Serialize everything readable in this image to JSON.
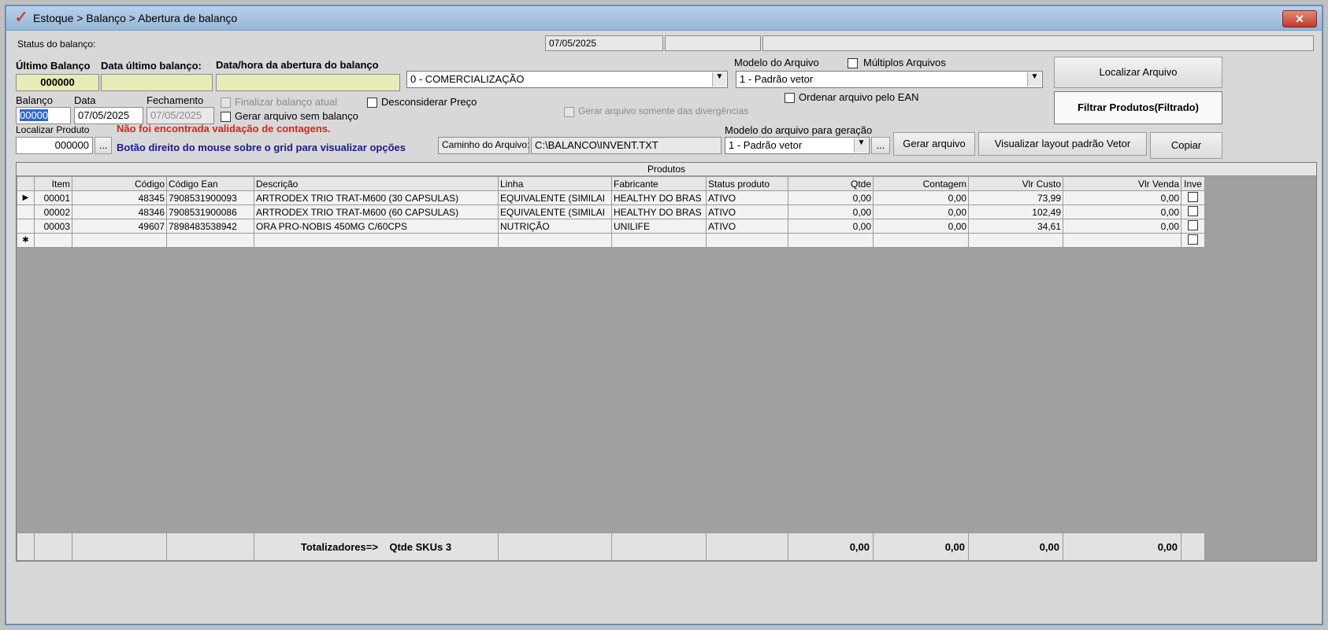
{
  "window": {
    "title": "Estoque > Balanço > Abertura de balanço",
    "close": "✕"
  },
  "status": {
    "label": "Status do balanço:",
    "date": "07/05/2025"
  },
  "header": {
    "ultimo_balanco_label": "Último Balanço",
    "ultimo_balanco_value": "000000",
    "data_ultimo_label": "Data último balanço:",
    "data_abertura_label": "Data/hora da abertura do balanço",
    "tipo_select": "0 - COMERCIALIZAÇÃO",
    "modelo_arquivo_label": "Modelo do Arquivo",
    "modelo_arquivo_select": "1 - Padrão vetor",
    "multiplos_label": "Múltiplos Arquivos",
    "localizar_arquivo_btn": "Localizar Arquivo",
    "filtrar_btn": "Filtrar Produtos(Filtrado)"
  },
  "balanco": {
    "balanco_label": "Balanço",
    "balanco_value": "00000",
    "data_label": "Data",
    "data_value": "07/05/2025",
    "fechamento_label": "Fechamento",
    "fechamento_value": "07/05/2025",
    "finalizar_label": "Finalizar balanço atual",
    "gerar_sem_label": "Gerar arquivo sem balanço",
    "desconsiderar_label": "Desconsiderar Preço",
    "gerar_divergencias_label": "Gerar arquivo somente das divergências",
    "ordenar_ean_label": "Ordenar arquivo pelo EAN"
  },
  "localizar": {
    "label": "Localizar Produto",
    "value": "000000",
    "dots": "...",
    "warning": "Não foi encontrada validação de contagens.",
    "hint": "Botão direito do mouse sobre o grid para visualizar opções"
  },
  "arquivo": {
    "caminho_label": "Caminho do Arquivo:",
    "caminho_value": "C:\\BALANCO\\INVENT.TXT",
    "modelo_geracao_label": "Modelo do arquivo para geração",
    "modelo_geracao_select": "1 - Padrão vetor",
    "dots": "...",
    "gerar_btn": "Gerar arquivo",
    "visualizar_btn": "Visualizar layout padrão Vetor",
    "copiar_btn": "Copiar"
  },
  "grid": {
    "caption": "Produtos",
    "columns": [
      "Item",
      "Código",
      "Código Ean",
      "Descrição",
      "Linha",
      "Fabricante",
      "Status produto",
      "Qtde",
      "Contagem",
      "Vlr Custo",
      "Vlr Venda",
      "Inve"
    ],
    "rows": [
      {
        "item": "00001",
        "codigo": "48345",
        "ean": "7908531900093",
        "descricao": "ARTRODEX TRIO TRAT-M600 (30 CAPSULAS)",
        "linha": "EQUIVALENTE (SIMILAI",
        "fabricante": "HEALTHY DO BRAS",
        "status": "ATIVO",
        "qtde": "0,00",
        "contagem": "0,00",
        "custo": "73,99",
        "venda": "0,00"
      },
      {
        "item": "00002",
        "codigo": "48346",
        "ean": "7908531900086",
        "descricao": "ARTRODEX TRIO TRAT-M600 (60 CAPSULAS)",
        "linha": "EQUIVALENTE (SIMILAI",
        "fabricante": "HEALTHY DO BRAS",
        "status": "ATIVO",
        "qtde": "0,00",
        "contagem": "0,00",
        "custo": "102,49",
        "venda": "0,00"
      },
      {
        "item": "00003",
        "codigo": "49607",
        "ean": "7898483538942",
        "descricao": "ORA PRO-NOBIS 450MG C/60CPS",
        "linha": "NUTRIÇÃO",
        "fabricante": "UNILIFE",
        "status": "ATIVO",
        "qtde": "0,00",
        "contagem": "0,00",
        "custo": "34,61",
        "venda": "0,00"
      }
    ],
    "new_row_marker": "✱",
    "current_row_marker": "▶"
  },
  "totals": {
    "label": "Totalizadores=>",
    "skus": "Qtde SKUs 3",
    "qtde": "0,00",
    "contagem": "0,00",
    "custo": "0,00",
    "venda": "0,00"
  }
}
